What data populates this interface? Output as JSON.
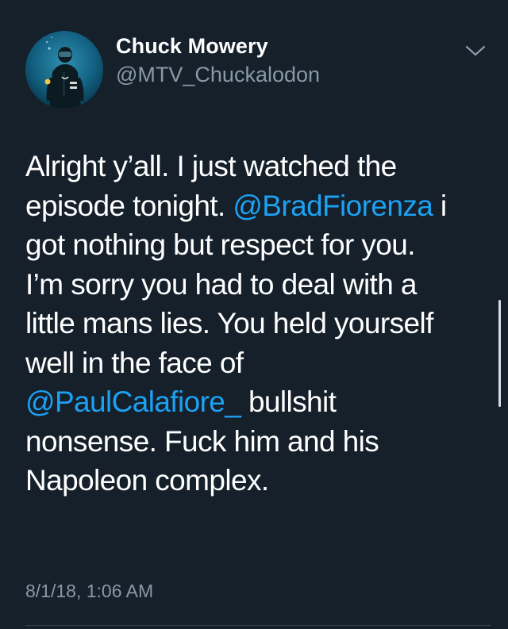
{
  "user": {
    "display_name": "Chuck Mowery",
    "handle": "@MTV_Chuckalodon",
    "avatar_icon": "scuba-diver-avatar"
  },
  "menu": {
    "icon": "chevron-down-icon"
  },
  "tweet": {
    "segments": {
      "l1": "Alright y’all. I just watched the",
      "l2a": "episode tonight. ",
      "l2_mention": "@BradFiorenza",
      "l2b": " i",
      "l3": "got nothing but respect for you.",
      "l4": "I’m sorry you had to deal with a",
      "l5": "little mans lies. You held yourself",
      "l6": "well in the face of",
      "l7_mention": "@PaulCalafiore_",
      "l7b": " bullshit",
      "l8": "nonsense. Fuck him and his",
      "l9": "Napoleon complex."
    },
    "timestamp": "8/1/18, 1:06 AM"
  },
  "colors": {
    "background": "#15202b",
    "text": "#ffffff",
    "secondary": "#8899a6",
    "link": "#1da1f2",
    "divider": "#38444d"
  }
}
